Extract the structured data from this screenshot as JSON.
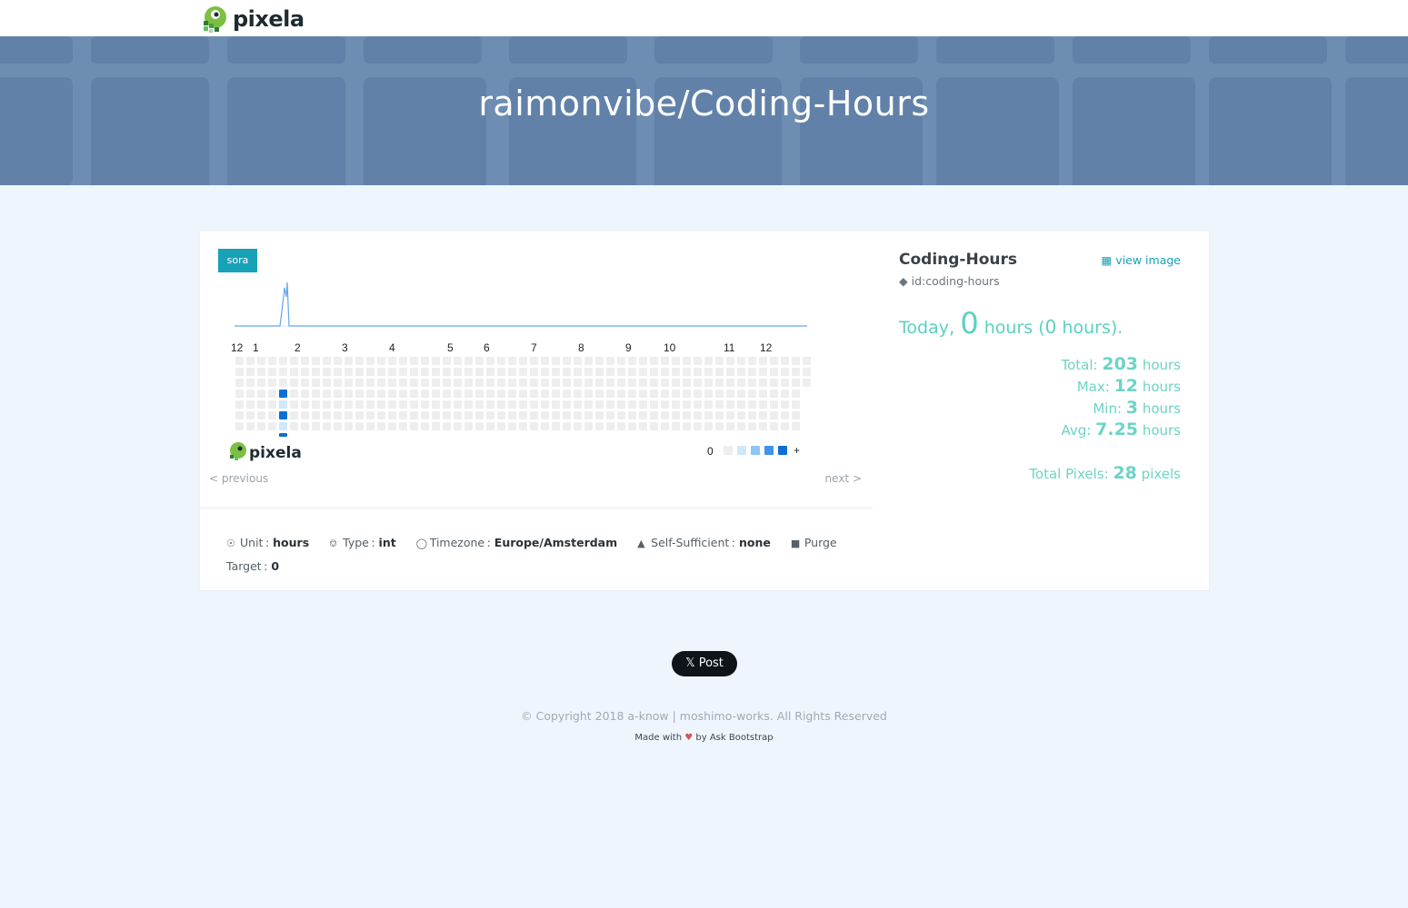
{
  "navbar": {
    "brand": "pixela"
  },
  "hero": {
    "title": "raimonvibe/Coding-Hours"
  },
  "graph": {
    "badge": "sora",
    "month_labels": [
      "12",
      "1",
      "2",
      "3",
      "4",
      "5",
      "6",
      "7",
      "8",
      "9",
      "10",
      "11",
      "12"
    ],
    "legend_min": "0",
    "legend_max": "+",
    "footer_brand": "pixela",
    "colors": {
      "empty": "#eeeeee",
      "lv1": "#cfe8fc",
      "lv2": "#8ec5f5",
      "lv3": "#3f93e8",
      "lv4": "#0d6fd3",
      "line": "#63a7ee"
    }
  },
  "pager": {
    "previous": "< previous",
    "next": "next >"
  },
  "meta": {
    "unit_label": "Unit :",
    "unit": "hours",
    "type_label": "Type :",
    "type": "int",
    "timezone_label": "Timezone :",
    "timezone": "Europe/Amsterdam",
    "self_label": "Self-Sufficient :",
    "self_sufficient": "none",
    "purge": "Purge",
    "target_label": "Target :",
    "target": "0"
  },
  "side": {
    "title": "Coding-Hours",
    "view_image": "view image",
    "id": "id:coding-hours",
    "today_label": "Today",
    "today_comma": ",",
    "today_value": "0",
    "today_unit_open": "hours (",
    "today_paren_value": "0",
    "today_unit_close": "hours).",
    "total_label": "Total:",
    "total": "203",
    "total_unit": "hours",
    "max_label": "Max:",
    "max": "12",
    "max_unit": "hours",
    "min_label": "Min:",
    "min": "3",
    "min_unit": "hours",
    "avg_label": "Avg:",
    "avg": "7.25",
    "avg_unit": "hours",
    "pixels_label": "Total Pixels:",
    "pixels": "28",
    "pixels_unit": "pixels"
  },
  "footer": {
    "tweet": "Post",
    "copyright": "© Copyright 2018 a-know | moshimo-works. All Rights Reserved",
    "made_with": "Made with",
    "heart": "♥",
    "by": "by Ask Bootstrap"
  }
}
